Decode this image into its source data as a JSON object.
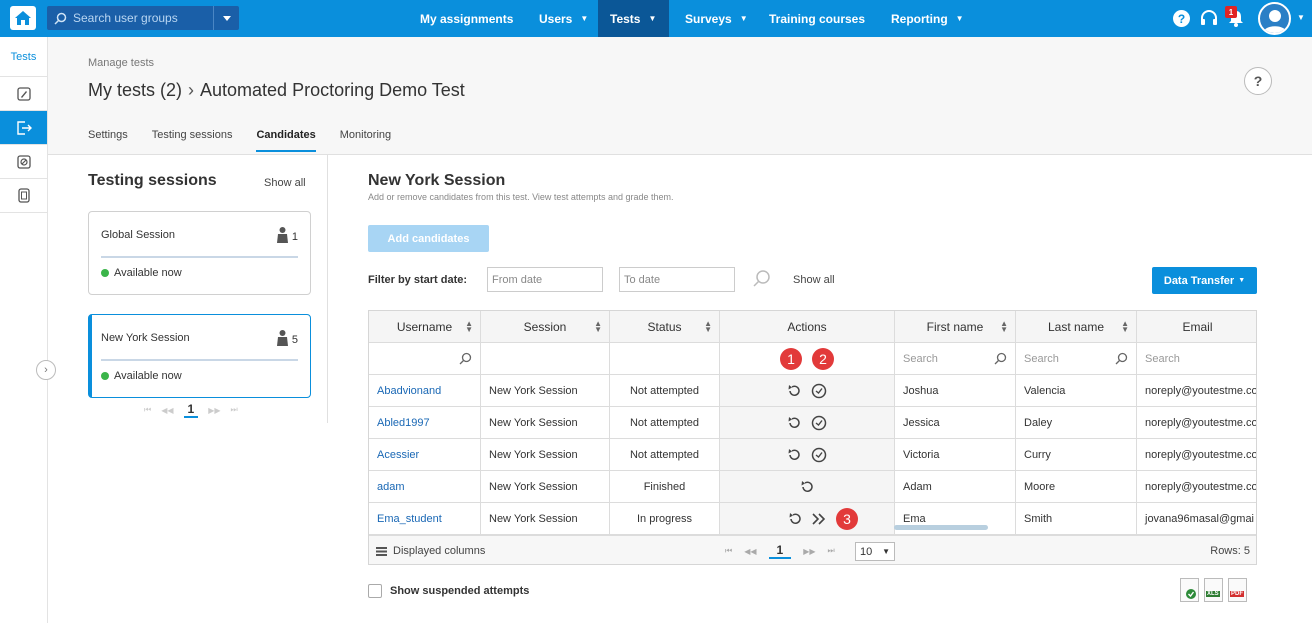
{
  "topbar": {
    "search_placeholder": "Search user groups",
    "nav": [
      {
        "label": "My assignments"
      },
      {
        "label": "Users"
      },
      {
        "label": "Tests"
      },
      {
        "label": "Surveys"
      },
      {
        "label": "Training courses"
      },
      {
        "label": "Reporting"
      }
    ],
    "notification_count": "1",
    "brand_color": "#0a8fdc"
  },
  "rail": {
    "title": "Tests"
  },
  "header": {
    "breadcrumb_small": "Manage tests",
    "breadcrumb_parent": "My tests (2)",
    "breadcrumb_current": "Automated Proctoring Demo Test",
    "help": "?",
    "tabs": [
      {
        "label": "Settings"
      },
      {
        "label": "Testing sessions"
      },
      {
        "label": "Candidates"
      },
      {
        "label": "Monitoring"
      }
    ]
  },
  "sessions": {
    "title": "Testing sessions",
    "show_all": "Show all",
    "items": [
      {
        "name": "Global Session",
        "count": "1",
        "status": "Available now"
      },
      {
        "name": "New York Session",
        "count": "5",
        "status": "Available now"
      }
    ],
    "page": "1"
  },
  "main": {
    "title": "New York Session",
    "subtitle": "Add or remove candidates from this test. View test attempts and grade them.",
    "add_button": "Add candidates",
    "filter_label": "Filter by start date:",
    "from_placeholder": "From date",
    "to_placeholder": "To date",
    "show_all": "Show all",
    "data_transfer": "Data Transfer"
  },
  "table": {
    "columns": [
      "Username",
      "Session",
      "Status",
      "Actions",
      "First name",
      "Last name",
      "Email"
    ],
    "search_placeholder": "Search",
    "annotations": [
      "1",
      "2",
      "3"
    ],
    "rows": [
      {
        "username": "Abadvionand",
        "session": "New York Session",
        "status": "Not attempted",
        "first": "Joshua",
        "last": "Valencia",
        "email": "noreply@youtestme.co"
      },
      {
        "username": "Abled1997",
        "session": "New York Session",
        "status": "Not attempted",
        "first": "Jessica",
        "last": "Daley",
        "email": "noreply@youtestme.co"
      },
      {
        "username": "Acessier",
        "session": "New York Session",
        "status": "Not attempted",
        "first": "Victoria",
        "last": "Curry",
        "email": "noreply@youtestme.co"
      },
      {
        "username": "adam",
        "session": "New York Session",
        "status": "Finished",
        "first": "Adam",
        "last": "Moore",
        "email": "noreply@youtestme.co"
      },
      {
        "username": "Ema_student",
        "session": "New York Session",
        "status": "In progress",
        "first": "Ema",
        "last": "Smith",
        "email": "jovana96masal@gmai"
      }
    ],
    "displayed_columns": "Displayed columns",
    "page": "1",
    "page_size": "10",
    "rows_count": "Rows: 5"
  },
  "bottom": {
    "suspended_label": "Show suspended attempts",
    "exports": [
      "XLS",
      "PDF"
    ]
  }
}
